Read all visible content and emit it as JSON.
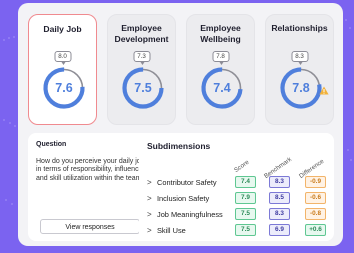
{
  "colors": {
    "background": "#7b63f0",
    "score_text": "#4f7fdc",
    "selected_border": "#f08a8f",
    "warning": "#f2b23a"
  },
  "cards": [
    {
      "title": "Daily Job",
      "benchmark": "8.0",
      "score": "7.6",
      "selected": true,
      "fill_fraction": 0.76
    },
    {
      "title": "Employee Development",
      "benchmark": "7.3",
      "score": "7.5",
      "selected": false,
      "fill_fraction": 0.75
    },
    {
      "title": "Employee Wellbeing",
      "benchmark": "7.8",
      "score": "7.4",
      "selected": false,
      "fill_fraction": 0.74
    },
    {
      "title": "Relationships",
      "benchmark": "8.3",
      "score": "7.8",
      "selected": false,
      "fill_fraction": 0.78,
      "icon": "warning-icon"
    }
  ],
  "question": {
    "label": "Question",
    "text": "How do you perceive your daily job in terms of responsibility, influence, and skill utilization within the team?",
    "button_label": "View responses"
  },
  "subdimensions": {
    "title": "Subdimensions",
    "columns": [
      "Score",
      "Benchmark",
      "Difference"
    ],
    "rows": [
      {
        "label": "Contributor Safety",
        "score": "7.4",
        "benchmark": "8.3",
        "difference": "-0.9",
        "positive": false
      },
      {
        "label": "Inclusion Safety",
        "score": "7.9",
        "benchmark": "8.5",
        "difference": "-0.6",
        "positive": false
      },
      {
        "label": "Job Meaningfulness",
        "score": "7.5",
        "benchmark": "8.3",
        "difference": "-0.8",
        "positive": false
      },
      {
        "label": "Skill Use",
        "score": "7.5",
        "benchmark": "6.9",
        "difference": "+0.6",
        "positive": true
      }
    ]
  }
}
